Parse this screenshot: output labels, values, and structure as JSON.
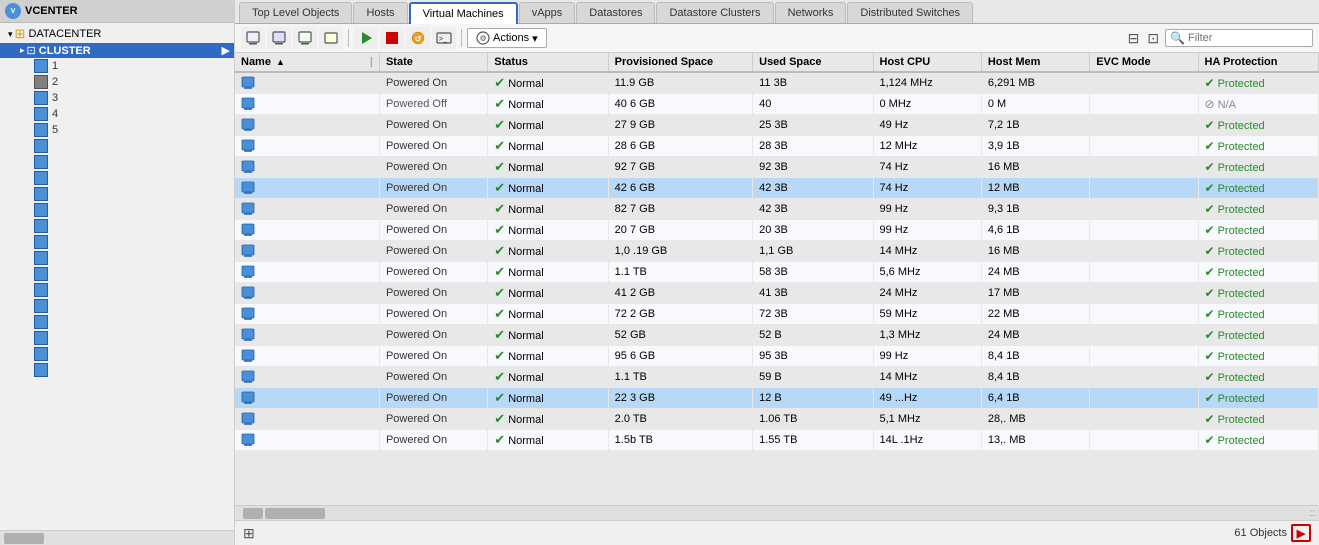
{
  "sidebar": {
    "vcenter_label": "VCENTER",
    "datacenter_label": "DATACENTER",
    "cluster_label": "CLUSTER",
    "items": [
      {
        "num": "1"
      },
      {
        "num": "2"
      },
      {
        "num": "3"
      },
      {
        "num": "4"
      },
      {
        "num": "5"
      }
    ]
  },
  "tabs": [
    {
      "label": "Top Level Objects",
      "active": false
    },
    {
      "label": "Hosts",
      "active": false
    },
    {
      "label": "Virtual Machines",
      "active": true
    },
    {
      "label": "vApps",
      "active": false
    },
    {
      "label": "Datastores",
      "active": false
    },
    {
      "label": "Datastore Clusters",
      "active": false
    },
    {
      "label": "Networks",
      "active": false
    },
    {
      "label": "Distributed Switches",
      "active": false
    }
  ],
  "toolbar": {
    "actions_label": "Actions",
    "filter_placeholder": "Filter"
  },
  "table": {
    "columns": [
      {
        "label": "Name",
        "sort": "asc"
      },
      {
        "label": "State"
      },
      {
        "label": "Status"
      },
      {
        "label": "Provisioned Space"
      },
      {
        "label": "Used Space"
      },
      {
        "label": "Host CPU"
      },
      {
        "label": "Host Mem"
      },
      {
        "label": "EVC Mode"
      },
      {
        "label": "HA Protection"
      }
    ],
    "rows": [
      {
        "state": "Powered On",
        "status": "Normal",
        "prov": "11.9 GB",
        "used": "11 3B",
        "hcpu": "1,124 MHz",
        "hmem": "6,291 MB",
        "evc": "",
        "ha": "Protected",
        "selected": false
      },
      {
        "state": "Powered Off",
        "status": "Normal",
        "prov": "40 6 GB",
        "used": "40",
        "hcpu": "0 MHz",
        "hmem": "0 M",
        "evc": "",
        "ha": "N/A",
        "selected": false
      },
      {
        "state": "Powered On",
        "status": "Normal",
        "prov": "27 9 GB",
        "used": "25 3B",
        "hcpu": "49 Hz",
        "hmem": "7,2 1B",
        "evc": "",
        "ha": "Protected",
        "selected": false
      },
      {
        "state": "Powered On",
        "status": "Normal",
        "prov": "28 6 GB",
        "used": "28 3B",
        "hcpu": "12 MHz",
        "hmem": "3,9 1B",
        "evc": "",
        "ha": "Protected",
        "selected": false
      },
      {
        "state": "Powered On",
        "status": "Normal",
        "prov": "92 7 GB",
        "used": "92 3B",
        "hcpu": "74 Hz",
        "hmem": "16 MB",
        "evc": "",
        "ha": "Protected",
        "selected": false
      },
      {
        "state": "Powered On",
        "status": "Normal",
        "prov": "42 6 GB",
        "used": "42 3B",
        "hcpu": "74 Hz",
        "hmem": "12 MB",
        "evc": "",
        "ha": "Protected",
        "selected": true
      },
      {
        "state": "Powered On",
        "status": "Normal",
        "prov": "82 7 GB",
        "used": "42 3B",
        "hcpu": "99 Hz",
        "hmem": "9,3 1B",
        "evc": "",
        "ha": "Protected",
        "selected": false
      },
      {
        "state": "Powered On",
        "status": "Normal",
        "prov": "20 7 GB",
        "used": "20 3B",
        "hcpu": "99 Hz",
        "hmem": "4,6 1B",
        "evc": "",
        "ha": "Protected",
        "selected": false
      },
      {
        "state": "Powered On",
        "status": "Normal",
        "prov": "1,0 .19 GB",
        "used": "1,1 GB",
        "hcpu": "14 MHz",
        "hmem": "16 MB",
        "evc": "",
        "ha": "Protected",
        "selected": false
      },
      {
        "state": "Powered On",
        "status": "Normal",
        "prov": "1.1 TB",
        "used": "58 3B",
        "hcpu": "5,6 MHz",
        "hmem": "24 MB",
        "evc": "",
        "ha": "Protected",
        "selected": false
      },
      {
        "state": "Powered On",
        "status": "Normal",
        "prov": "41 2 GB",
        "used": "41 3B",
        "hcpu": "24 MHz",
        "hmem": "17 MB",
        "evc": "",
        "ha": "Protected",
        "selected": false
      },
      {
        "state": "Powered On",
        "status": "Normal",
        "prov": "72 2 GB",
        "used": "72 3B",
        "hcpu": "59 MHz",
        "hmem": "22 MB",
        "evc": "",
        "ha": "Protected",
        "selected": false
      },
      {
        "state": "Powered On",
        "status": "Normal",
        "prov": "52 GB",
        "used": "52 B",
        "hcpu": "1,3 MHz",
        "hmem": "24 MB",
        "evc": "",
        "ha": "Protected",
        "selected": false
      },
      {
        "state": "Powered On",
        "status": "Normal",
        "prov": "95 6 GB",
        "used": "95 3B",
        "hcpu": "99 Hz",
        "hmem": "8,4 1B",
        "evc": "",
        "ha": "Protected",
        "selected": false
      },
      {
        "state": "Powered On",
        "status": "Normal",
        "prov": "1.1 TB",
        "used": "59 B",
        "hcpu": "14 MHz",
        "hmem": "8,4 1B",
        "evc": "",
        "ha": "Protected",
        "selected": false
      },
      {
        "state": "Powered On",
        "status": "Normal",
        "prov": "22 3 GB",
        "used": "12 B",
        "hcpu": "49 ...Hz",
        "hmem": "6,4 1B",
        "evc": "",
        "ha": "Protected",
        "selected": true
      },
      {
        "state": "Powered On",
        "status": "Normal",
        "prov": "2.0 TB",
        "used": "1.06 TB",
        "hcpu": "5,1 MHz",
        "hmem": "28,. MB",
        "evc": "",
        "ha": "Protected",
        "selected": false
      },
      {
        "state": "Powered On",
        "status": "Normal",
        "prov": "1.5b TB",
        "used": "1.55 TB",
        "hcpu": "14L .1Hz",
        "hmem": "13,. MB",
        "evc": "",
        "ha": "Protected",
        "selected": false
      }
    ]
  },
  "bottom": {
    "object_count": "61 Objects"
  },
  "icons": {
    "filter": "⊟",
    "export": "⊡",
    "actions_arrow": "▾"
  }
}
